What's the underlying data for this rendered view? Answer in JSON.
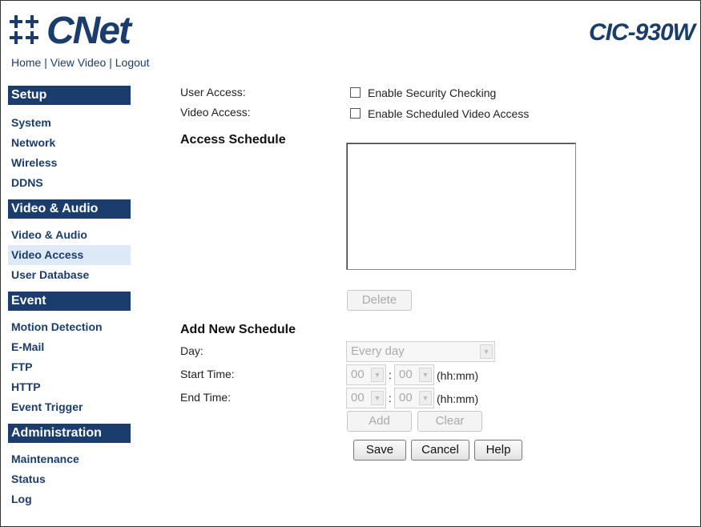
{
  "brand": {
    "logo_text": "CNet",
    "model": "CIC-930W",
    "accent": "#1a3d6e"
  },
  "top_links": {
    "home": "Home",
    "view_video": "View Video",
    "logout": "Logout",
    "sep": " | "
  },
  "sidebar": {
    "sections": [
      {
        "title": "Setup",
        "items": [
          "System",
          "Network",
          "Wireless",
          "DDNS"
        ]
      },
      {
        "title": "Video & Audio",
        "items": [
          "Video & Audio",
          "Video Access",
          "User Database"
        ]
      },
      {
        "title": "Event",
        "items": [
          "Motion Detection",
          "E-Mail",
          "FTP",
          "HTTP",
          "Event Trigger"
        ]
      },
      {
        "title": "Administration",
        "items": [
          "Maintenance",
          "Status",
          "Log"
        ]
      }
    ],
    "active_item": "Video Access"
  },
  "form": {
    "user_access_label": "User Access:",
    "security_check_label": "Enable Security Checking",
    "video_access_label": "Video Access:",
    "scheduled_access_label": "Enable Scheduled Video Access",
    "access_schedule_heading": "Access Schedule",
    "delete_button": "Delete",
    "add_schedule_heading": "Add New Schedule",
    "day_label": "Day:",
    "day_value": "Every day",
    "start_label": "Start Time:",
    "end_label": "End Time:",
    "hour_value": "00",
    "minute_value": "00",
    "colon": ":",
    "time_hint": "(hh:mm)",
    "add_button": "Add",
    "clear_button": "Clear",
    "save_button": "Save",
    "cancel_button": "Cancel",
    "help_button": "Help"
  }
}
